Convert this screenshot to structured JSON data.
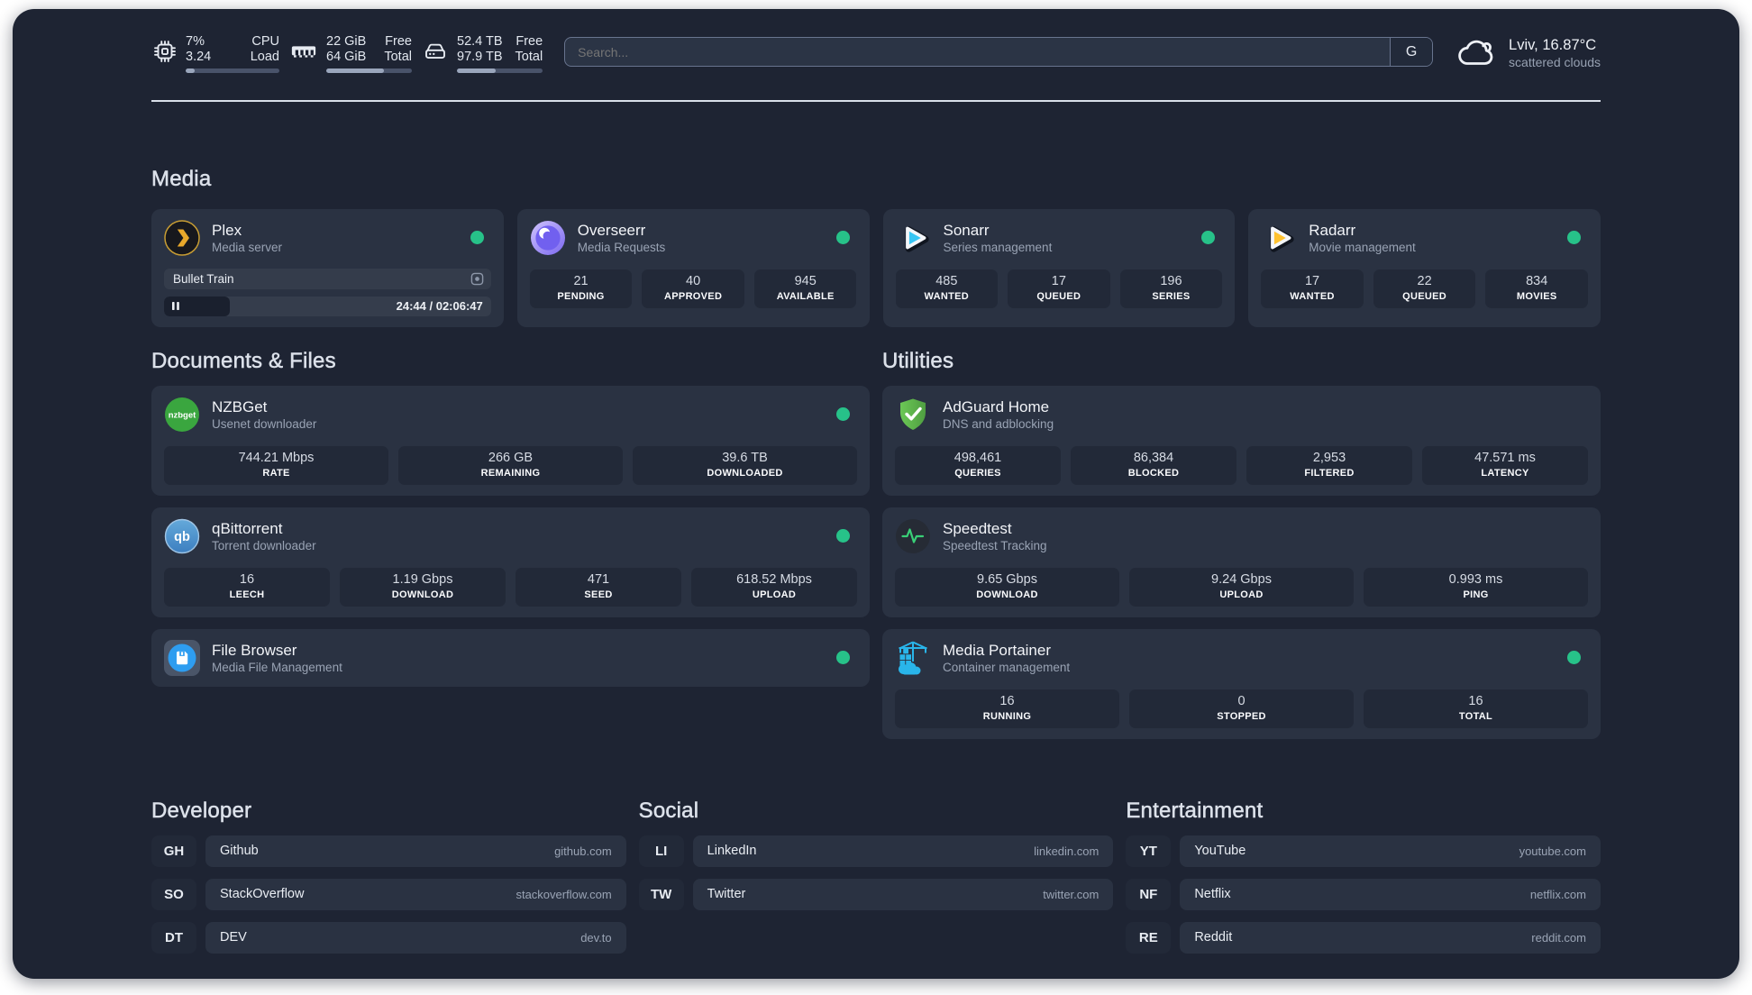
{
  "topbar": {
    "cpu": {
      "icon": "cpu-icon",
      "value_top": "7%",
      "value_bottom": "3.24",
      "label_top": "CPU",
      "label_bottom": "Load",
      "percent": 10
    },
    "memory": {
      "icon": "memory-icon",
      "value_top": "22 GiB",
      "value_bottom": "64 GiB",
      "label_top": "Free",
      "label_bottom": "Total",
      "percent": 67
    },
    "disk": {
      "icon": "disk-icon",
      "value_top": "52.4 TB",
      "value_bottom": "97.9 TB",
      "label_top": "Free",
      "label_bottom": "Total",
      "percent": 45
    },
    "search": {
      "placeholder": "Search...",
      "button_label": "G"
    },
    "weather": {
      "icon": "cloud-icon",
      "summary": "Lviv, 16.87°C",
      "condition": "scattered clouds"
    }
  },
  "colors": {
    "status_green": "#27c289",
    "accent_plex": "#eba31d",
    "accent_sonarr": "#35c5f4",
    "accent_radarr": "#ffc230"
  },
  "sections": {
    "media": "Media",
    "documents": "Documents & Files",
    "utilities": "Utilities",
    "developer": "Developer",
    "social": "Social",
    "entertainment": "Entertainment"
  },
  "services": {
    "plex": {
      "icon": "plex-icon",
      "name": "Plex",
      "desc": "Media server",
      "online": true,
      "now_playing": "Bullet Train",
      "time": "24:44 / 02:06:47",
      "progress_percent": 20
    },
    "overseerr": {
      "icon": "overseerr-icon",
      "name": "Overseerr",
      "desc": "Media Requests",
      "online": true,
      "stats": [
        {
          "value": "21",
          "label": "PENDING"
        },
        {
          "value": "40",
          "label": "APPROVED"
        },
        {
          "value": "945",
          "label": "AVAILABLE"
        }
      ]
    },
    "sonarr": {
      "icon": "sonarr-icon",
      "name": "Sonarr",
      "desc": "Series management",
      "online": true,
      "stats": [
        {
          "value": "485",
          "label": "WANTED"
        },
        {
          "value": "17",
          "label": "QUEUED"
        },
        {
          "value": "196",
          "label": "SERIES"
        }
      ]
    },
    "radarr": {
      "icon": "radarr-icon",
      "name": "Radarr",
      "desc": "Movie management",
      "online": true,
      "stats": [
        {
          "value": "17",
          "label": "WANTED"
        },
        {
          "value": "22",
          "label": "QUEUED"
        },
        {
          "value": "834",
          "label": "MOVIES"
        }
      ]
    },
    "nzbget": {
      "icon": "nzbget-icon",
      "name": "NZBGet",
      "desc": "Usenet downloader",
      "online": true,
      "stats": [
        {
          "value": "744.21 Mbps",
          "label": "RATE"
        },
        {
          "value": "266 GB",
          "label": "REMAINING"
        },
        {
          "value": "39.6 TB",
          "label": "DOWNLOADED"
        }
      ]
    },
    "qbittorrent": {
      "icon": "qbittorrent-icon",
      "name": "qBittorrent",
      "desc": "Torrent downloader",
      "online": true,
      "stats": [
        {
          "value": "16",
          "label": "LEECH"
        },
        {
          "value": "1.19 Gbps",
          "label": "DOWNLOAD"
        },
        {
          "value": "471",
          "label": "SEED"
        },
        {
          "value": "618.52 Mbps",
          "label": "UPLOAD"
        }
      ]
    },
    "filebrowser": {
      "icon": "filebrowser-icon",
      "name": "File Browser",
      "desc": "Media File Management",
      "online": true
    },
    "adguard": {
      "icon": "adguard-icon",
      "name": "AdGuard Home",
      "desc": "DNS and adblocking",
      "online": null,
      "stats": [
        {
          "value": "498,461",
          "label": "QUERIES"
        },
        {
          "value": "86,384",
          "label": "BLOCKED"
        },
        {
          "value": "2,953",
          "label": "FILTERED"
        },
        {
          "value": "47.571 ms",
          "label": "LATENCY"
        }
      ]
    },
    "speedtest": {
      "icon": "speedtest-icon",
      "name": "Speedtest",
      "desc": "Speedtest Tracking",
      "online": null,
      "stats": [
        {
          "value": "9.65 Gbps",
          "label": "DOWNLOAD"
        },
        {
          "value": "9.24 Gbps",
          "label": "UPLOAD"
        },
        {
          "value": "0.993 ms",
          "label": "PING"
        }
      ]
    },
    "portainer": {
      "icon": "portainer-icon",
      "name": "Media Portainer",
      "desc": "Container management",
      "online": true,
      "stats": [
        {
          "value": "16",
          "label": "RUNNING"
        },
        {
          "value": "0",
          "label": "STOPPED"
        },
        {
          "value": "16",
          "label": "TOTAL"
        }
      ]
    }
  },
  "bookmarks": {
    "developer": [
      {
        "abbr": "GH",
        "name": "Github",
        "url": "github.com"
      },
      {
        "abbr": "SO",
        "name": "StackOverflow",
        "url": "stackoverflow.com"
      },
      {
        "abbr": "DT",
        "name": "DEV",
        "url": "dev.to"
      }
    ],
    "social": [
      {
        "abbr": "LI",
        "name": "LinkedIn",
        "url": "linkedin.com"
      },
      {
        "abbr": "TW",
        "name": "Twitter",
        "url": "twitter.com"
      }
    ],
    "entertainment": [
      {
        "abbr": "YT",
        "name": "YouTube",
        "url": "youtube.com"
      },
      {
        "abbr": "NF",
        "name": "Netflix",
        "url": "netflix.com"
      },
      {
        "abbr": "RE",
        "name": "Reddit",
        "url": "reddit.com"
      }
    ]
  }
}
